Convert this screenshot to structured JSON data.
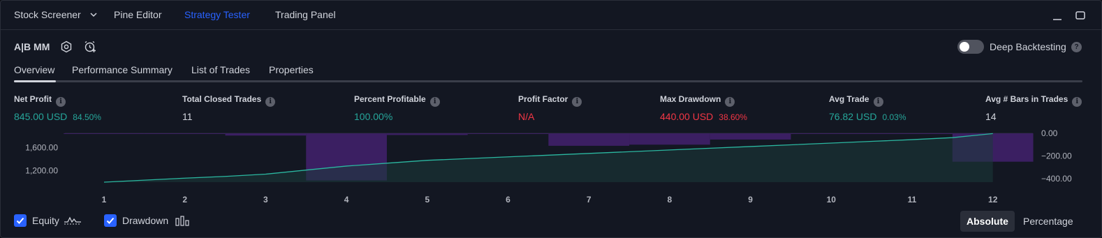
{
  "top_tabs": [
    {
      "label": "Stock Screener",
      "active": false
    },
    {
      "label": "Pine Editor",
      "active": false
    },
    {
      "label": "Strategy Tester",
      "active": true
    },
    {
      "label": "Trading Panel",
      "active": false
    }
  ],
  "strategy": {
    "name": "A|B MM",
    "deep_backtesting_label": "Deep Backtesting",
    "deep_backtesting_on": false
  },
  "sub_tabs": [
    {
      "label": "Overview",
      "active": true
    },
    {
      "label": "Performance Summary",
      "active": false
    },
    {
      "label": "List of Trades",
      "active": false
    },
    {
      "label": "Properties",
      "active": false
    }
  ],
  "metrics": [
    {
      "label": "Net Profit",
      "value": "845.00 USD",
      "pct": "84.50%",
      "tone": "pos"
    },
    {
      "label": "Total Closed Trades",
      "value": "11",
      "pct": "",
      "tone": "neutral"
    },
    {
      "label": "Percent Profitable",
      "value": "100.00%",
      "pct": "",
      "tone": "pos"
    },
    {
      "label": "Profit Factor",
      "value": "N/A",
      "pct": "",
      "tone": "neg"
    },
    {
      "label": "Max Drawdown",
      "value": "440.00 USD",
      "pct": "38.60%",
      "tone": "neg"
    },
    {
      "label": "Avg Trade",
      "value": "76.82 USD",
      "pct": "0.03%",
      "tone": "pos"
    },
    {
      "label": "Avg # Bars in Trades",
      "value": "14",
      "pct": "",
      "tone": "neutral"
    }
  ],
  "chart_data": {
    "type": "line",
    "x": [
      1,
      2,
      3,
      4,
      5,
      6,
      7,
      8,
      9,
      10,
      11,
      12
    ],
    "left_axis_ticks": [
      "1,600.00",
      "1,200.00"
    ],
    "right_axis_ticks": [
      "0.00",
      "−200.00",
      "−400.00"
    ],
    "left_ylim": [
      1000,
      1850
    ],
    "right_ylim": [
      -430,
      0
    ],
    "series": [
      {
        "name": "Equity",
        "axis": "left",
        "x": [
          1,
          1.5,
          2,
          2.5,
          3,
          3.5,
          4,
          4.5,
          5,
          5.5,
          6,
          6.5,
          7,
          7.5,
          8,
          8.5,
          9,
          9.5,
          10,
          10.5,
          11,
          11.5,
          12
        ],
        "y": [
          1000,
          1035,
          1070,
          1100,
          1140,
          1210,
          1280,
          1330,
          1380,
          1410,
          1440,
          1470,
          1500,
          1530,
          1560,
          1590,
          1620,
          1650,
          1680,
          1710,
          1740,
          1775,
          1845
        ]
      },
      {
        "name": "Drawdown",
        "axis": "right",
        "type": "bar",
        "x": [
          1,
          2,
          3,
          4,
          5,
          6,
          7,
          8,
          9,
          10,
          11,
          12
        ],
        "y": [
          0,
          -5,
          -20,
          -415,
          -15,
          0,
          -110,
          -100,
          -55,
          0,
          -3,
          -250
        ]
      }
    ],
    "colors": {
      "equity_line": "#2bb7a0",
      "equity_fill": "#1c3a3a",
      "drawdown": "#3d2066"
    },
    "legend": [
      "Equity",
      "Drawdown"
    ]
  },
  "legend_checks": [
    {
      "label": "Equity",
      "checked": true,
      "icon": "equity-line-icon"
    },
    {
      "label": "Drawdown",
      "checked": true,
      "icon": "drawdown-bars-icon"
    }
  ],
  "mode_toggle": {
    "absolute": "Absolute",
    "percentage": "Percentage",
    "selected": "Absolute"
  }
}
